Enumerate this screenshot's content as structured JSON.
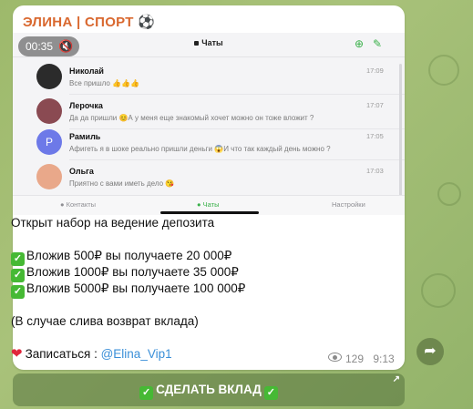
{
  "post": {
    "channel_name": "ЭЛИНА | СПОРТ ⚽",
    "media": {
      "duration": "00:35",
      "header_title": "Чаты",
      "chats": [
        {
          "name": "Николай",
          "text": "Все пришло 👍👍👍",
          "time": "17:09",
          "avatar_color": "#2b2b2b"
        },
        {
          "name": "Лерочка",
          "text": "Да да пришли 😊А у меня еще знакомый хочет можно он тоже вложит ?",
          "time": "17:07",
          "avatar_color": "#8a4a52"
        },
        {
          "name": "Рамиль",
          "text": "Афигеть я в шоке реально пришли деньги 😱И что так каждый день можно ?",
          "time": "17:05",
          "avatar_color": "#6d79e8",
          "initial": "Р"
        },
        {
          "name": "Ольга",
          "text": "Приятно с вами иметь дело 😘",
          "time": "17:03",
          "avatar_color": "#e9a88a"
        }
      ],
      "tabs": [
        {
          "label": "Контакты"
        },
        {
          "label": "Чаты"
        },
        {
          "label": "Настройки"
        }
      ]
    },
    "lines": {
      "intro": "Открыт набор на ведение депозита",
      "offer1": "Вложив 500₽ вы получаете 20 000₽",
      "offer2": "Вложив 1000₽ вы получаете 35 000₽",
      "offer3": "Вложив 5000₽ вы получаете 100 000₽",
      "refund": "(В случае слива возврат вклада)",
      "signup_label": "Записаться : ",
      "signup_link": "@Elina_Vip1"
    },
    "views": "129",
    "time": "9:13"
  },
  "cta_button": {
    "label": "СДЕЛАТЬ ВКЛАД"
  },
  "icons": {
    "check": "check-mark-icon",
    "heart": "heart-icon",
    "eye": "eye-icon",
    "share": "share-arrow-icon",
    "external": "external-link-icon",
    "mute": "muted-speaker-icon"
  },
  "colors": {
    "channel_name": "#d9682f",
    "link": "#3a8fd8",
    "accent_green": "#3ab14a",
    "check_green": "#46b934"
  }
}
